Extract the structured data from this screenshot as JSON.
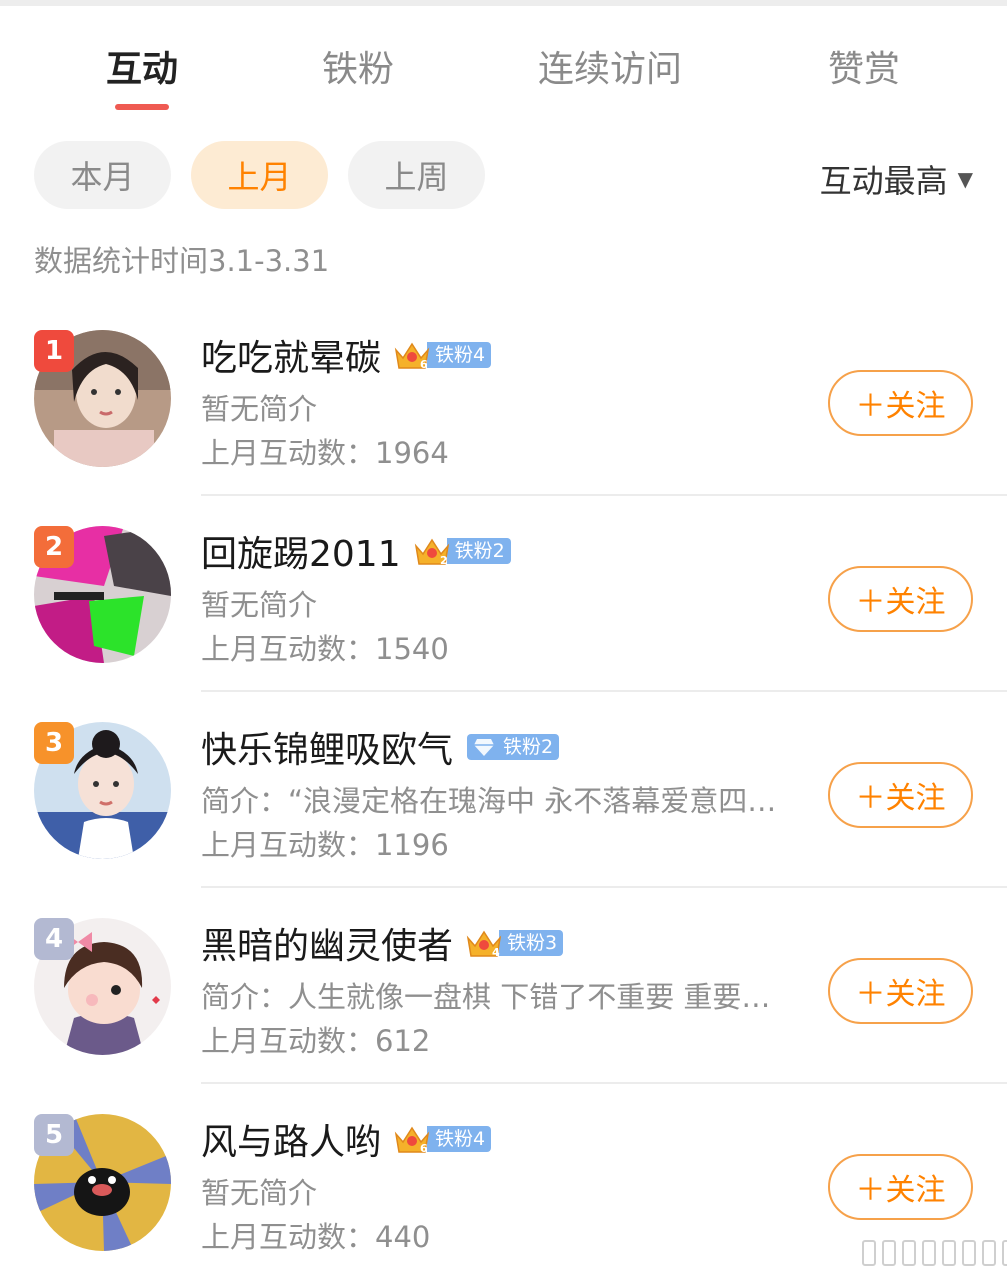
{
  "tabs": [
    {
      "label": "互动",
      "active": true
    },
    {
      "label": "铁粉",
      "active": false
    },
    {
      "label": "连续访问",
      "active": false
    },
    {
      "label": "赞赏",
      "active": false
    }
  ],
  "filters": [
    {
      "label": "本月",
      "active": false
    },
    {
      "label": "上月",
      "active": true
    },
    {
      "label": "上周",
      "active": false
    }
  ],
  "sort": {
    "label": "互动最高",
    "icon": "caret-down-icon"
  },
  "stat_time": "数据统计时间3.1-3.31",
  "follow_label": "＋关注",
  "colors": {
    "accent": "#ff8200",
    "tab_indicator": "#ef5a52",
    "badge_blue": "#7fb2ee"
  },
  "users": [
    {
      "rank": "1",
      "rank_color": "#ef4a3d",
      "name": "吃吃就晕碳",
      "emblem": "crown",
      "emblem_level": "6",
      "badge": "铁粉4",
      "bio": "暂无简介",
      "count": "上月互动数：1964"
    },
    {
      "rank": "2",
      "rank_color": "#f36d3a",
      "name": "回旋踢2011",
      "emblem": "crown",
      "emblem_level": "2",
      "badge": "铁粉2",
      "bio": "暂无简介",
      "count": "上月互动数：1540"
    },
    {
      "rank": "3",
      "rank_color": "#f7922a",
      "name": "快乐锦鲤吸欧气",
      "emblem": "diamond",
      "emblem_level": "",
      "badge": "铁粉2",
      "bio": "简介：“浪漫定格在瑰海中 永不落幕爱意四…",
      "count": "上月互动数：1196"
    },
    {
      "rank": "4",
      "rank_color": "#b3b9d2",
      "name": "黑暗的幽灵使者",
      "emblem": "crown",
      "emblem_level": "4",
      "badge": "铁粉3",
      "bio": "简介：人生就像一盘棋 下错了不重要 重要…",
      "count": "上月互动数：612"
    },
    {
      "rank": "5",
      "rank_color": "#b3b9d2",
      "name": "风与路人哟",
      "emblem": "crown",
      "emblem_level": "6",
      "badge": "铁粉4",
      "bio": "暂无简介",
      "count": "上月互动数：440"
    }
  ]
}
